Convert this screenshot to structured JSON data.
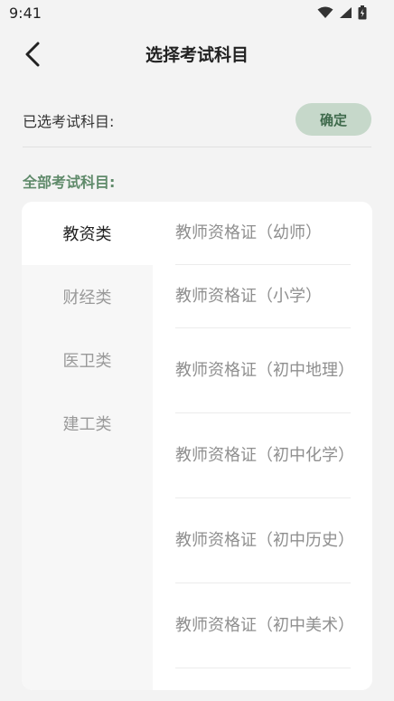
{
  "status_bar": {
    "time": "9:41"
  },
  "header": {
    "title": "选择考试科目"
  },
  "selected": {
    "label": "已选考试科目:",
    "confirm_label": "确定"
  },
  "all_subjects_heading": "全部考试科目:",
  "categories": [
    {
      "label": "教资类",
      "active": true
    },
    {
      "label": "财经类",
      "active": false
    },
    {
      "label": "医卫类",
      "active": false
    },
    {
      "label": "建工类",
      "active": false
    }
  ],
  "subjects": [
    {
      "label": "教师资格证（幼师）"
    },
    {
      "label": "教师资格证（小学）"
    },
    {
      "label": "教师资格证（初中地理）"
    },
    {
      "label": "教师资格证（初中化学）"
    },
    {
      "label": "教师资格证（初中历史）"
    },
    {
      "label": "教师资格证（初中美术）"
    }
  ],
  "colors": {
    "accent": "#5f8a6a",
    "confirm_bg": "#c6d8ca",
    "background": "#f3f3f3"
  }
}
